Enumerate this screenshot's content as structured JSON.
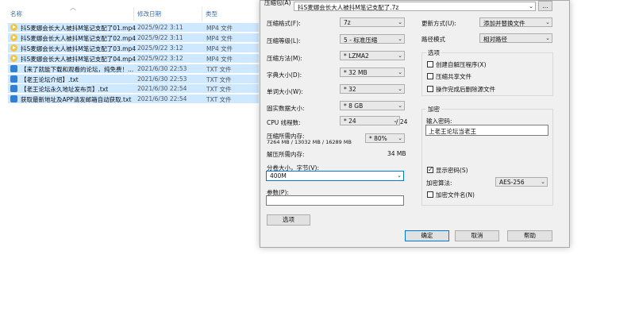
{
  "explorer": {
    "columns": {
      "name": "名称",
      "date": "修改日期",
      "type": "类型"
    },
    "files": [
      {
        "name": "抖S麦娜会长大人被抖M笔记支配了01.mp4",
        "date": "2025/9/22 3:11",
        "type": "MP4 文件",
        "kind": "mp4"
      },
      {
        "name": "抖S麦娜会长大人被抖M笔记支配了02.mp4",
        "date": "2025/9/22 3:11",
        "type": "MP4 文件",
        "kind": "mp4"
      },
      {
        "name": "抖S麦娜会长大人被抖M笔记支配了03.mp4",
        "date": "2025/9/22 3:12",
        "type": "MP4 文件",
        "kind": "mp4"
      },
      {
        "name": "抖S麦娜会长大人被抖M笔记支配了04.mp4",
        "date": "2025/9/22 3:12",
        "type": "MP4 文件",
        "kind": "mp4"
      },
      {
        "name": "【来了就能下载和观看的论坛，纯免费！...",
        "date": "2021/6/30 22:53",
        "type": "TXT 文件",
        "kind": "txt"
      },
      {
        "name": "【老王论坛介绍】.txt",
        "date": "2021/6/30 22:53",
        "type": "TXT 文件",
        "kind": "txt"
      },
      {
        "name": "【老王论坛永久地址发布页】.txt",
        "date": "2021/6/30 22:54",
        "type": "TXT 文件",
        "kind": "txt"
      },
      {
        "name": "获取最新地址及APP请发邮箱自动获取.txt",
        "date": "2021/6/30 22:54",
        "type": "TXT 文件",
        "kind": "txt"
      }
    ]
  },
  "dialog": {
    "archive_label": "压缩包(A)",
    "archive_value": "抖S麦娜会长大人被抖M笔记支配了.7z",
    "browse_label": "...",
    "format_label": "压缩格式(F):",
    "format_value": "7z",
    "level_label": "压缩等级(L):",
    "level_value": "5 - 标准压缩",
    "method_label": "压缩方法(M):",
    "method_value": "* LZMA2",
    "dict_label": "字典大小(D):",
    "dict_value": "* 32 MB",
    "word_label": "单词大小(W):",
    "word_value": "* 32",
    "solid_label": "固实数据大小:",
    "solid_value": "* 8 GB",
    "threads_label": "CPU 线程数:",
    "threads_value": "* 24",
    "threads_total": "/ 24",
    "mem_label": "压缩所需内存:",
    "mem_detail": "7264 MB / 13032 MB / 16289 MB",
    "mem_value": "* 80%",
    "decomp_label": "解压所需内存:",
    "decomp_value": "34 MB",
    "split_label": "分卷大小，字节(V):",
    "split_value": "400M",
    "params_label": "参数(P):",
    "params_value": "",
    "options_button": "选项",
    "update_label": "更新方式(U):",
    "update_value": "添加并替换文件",
    "path_label": "路径模式",
    "path_value": "相对路径",
    "options_group": "选项",
    "opt_sfx": "创建自解压程序(X)",
    "opt_shared": "压缩共享文件",
    "opt_delete": "操作完成后删除源文件",
    "enc_group": "加密",
    "pwd_label": "输入密码:",
    "pwd_value": "上老王论坛当老王",
    "show_pwd": "显示密码(S)",
    "enc_method_label": "加密算法:",
    "enc_method_value": "AES-256",
    "enc_names": "加密文件名(N)",
    "ok": "确定",
    "cancel": "取消",
    "help": "帮助"
  }
}
